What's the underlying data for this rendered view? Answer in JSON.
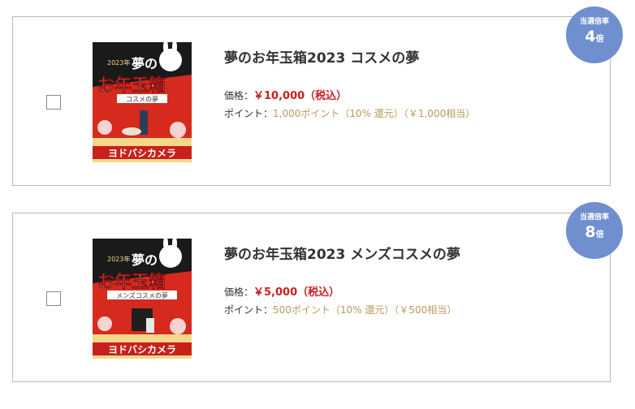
{
  "items": [
    {
      "title": "夢のお年玉箱2023 コスメの夢",
      "price_label": "価格：",
      "price": "￥10,000（税込）",
      "point_label": "ポイント：",
      "point_text": "1,000ポイント（10% 還元）（￥1,000相当）",
      "badge_label": "当選倍率",
      "badge_number": "4",
      "badge_unit": "倍",
      "image": {
        "year": "2023年",
        "big1": "夢の",
        "big2": "お年玉箱",
        "ribbon": "コスメの夢",
        "store": "ヨドバシカメラ"
      }
    },
    {
      "title": "夢のお年玉箱2023 メンズコスメの夢",
      "price_label": "価格：",
      "price": "￥5,000（税込）",
      "point_label": "ポイント：",
      "point_text": "500ポイント（10% 還元）（￥500相当）",
      "badge_label": "当選倍率",
      "badge_number": "8",
      "badge_unit": "倍",
      "image": {
        "year": "2023年",
        "big1": "夢の",
        "big2": "お年玉箱",
        "ribbon": "メンズコスメの夢",
        "store": "ヨドバシカメラ"
      }
    }
  ],
  "colors": {
    "price": "#cc1f1f",
    "point": "#b99a5e",
    "badge": "#6f8fcf",
    "border": "#b8b8b8"
  }
}
